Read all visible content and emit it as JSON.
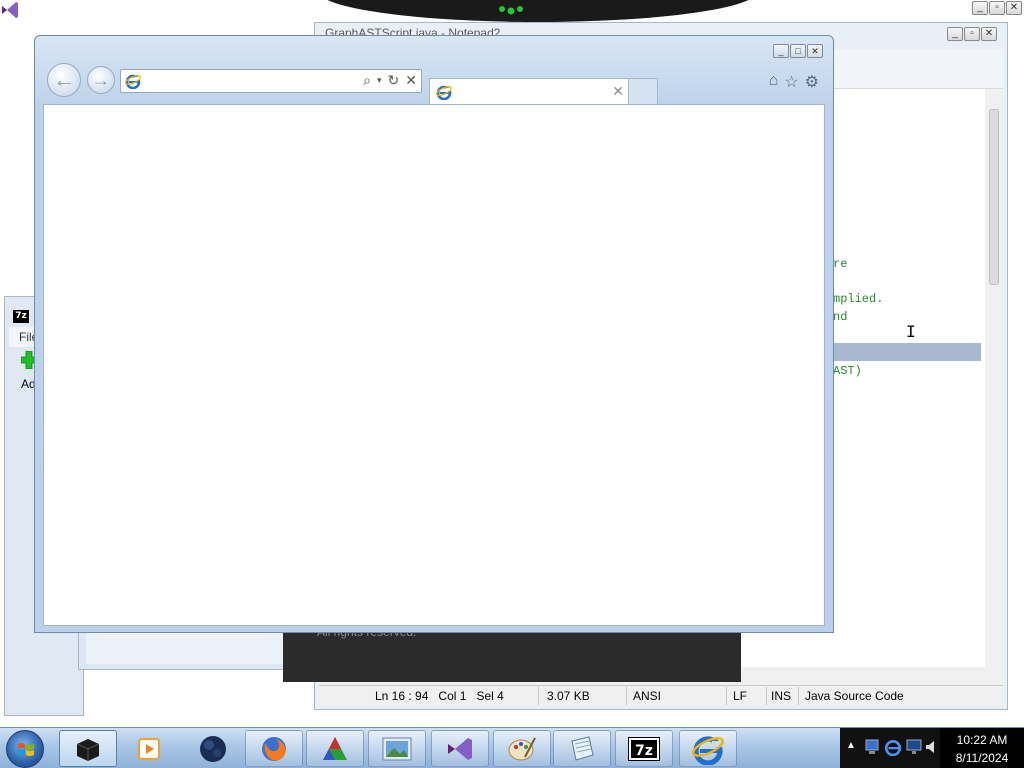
{
  "background": {
    "notepad": {
      "title": "GraphASTScript.java - Notepad2",
      "code_lines": [
        "re",
        "mplied.",
        "nd",
        "AST)"
      ],
      "status": {
        "position": "Ln 16 : 94",
        "column": "Col 1",
        "selection": "Sel 4",
        "size": "3.07 KB",
        "encoding": "ANSI",
        "line_ending": "LF",
        "mode": "INS",
        "language": "Java Source Code"
      }
    },
    "sevenzip": {
      "icon_text": "7z",
      "menu_file": "File",
      "add_label": "Add"
    },
    "about_box": {
      "text": "All rights reserved."
    }
  },
  "ie": {
    "address": {
      "value": "",
      "placeholder": ""
    },
    "tab": {
      "title": ""
    },
    "icons": [
      "home-icon",
      "favorites-star-icon",
      "settings-gear-icon"
    ]
  },
  "taskbar": {
    "items": [
      "windows-security-app",
      "media-player-app",
      "night-sky-app",
      "firefox-app",
      "color-triangle-app",
      "image-viewer-app",
      "visual-studio-app",
      "paint-app",
      "notepad2-app",
      "7zip-app",
      "internet-explorer-app"
    ],
    "sevenzip_label": "7z",
    "clock": {
      "time": "10:22 AM",
      "date": "8/11/2024"
    }
  },
  "colors": {
    "taskbar": "#a9c6e6",
    "ie_frame": "#c9dbef",
    "code_comment": "#2a8a2a",
    "selection": "#a9b7cf"
  }
}
